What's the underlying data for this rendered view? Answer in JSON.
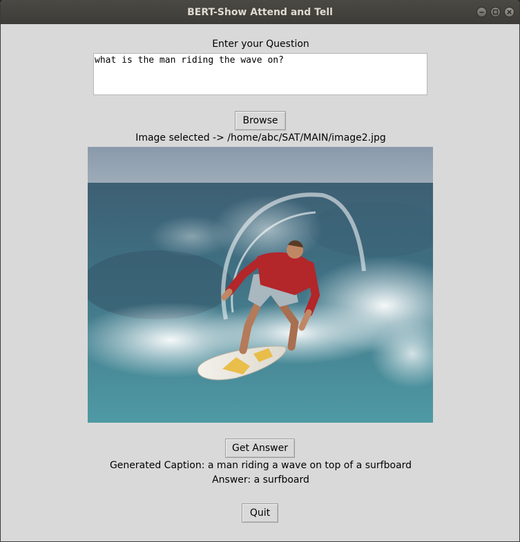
{
  "window": {
    "title": "BERT-Show Attend and Tell"
  },
  "question": {
    "label": "Enter your Question",
    "value": "what is the man riding the wave on?"
  },
  "browse": {
    "label": "Browse"
  },
  "image": {
    "selected_text": "Image selected -> /home/abc/SAT/MAIN/image2.jpg",
    "subject": "surfer riding a wave on a surfboard"
  },
  "get_answer": {
    "label": "Get Answer"
  },
  "results": {
    "caption": "Generated Caption: a man riding a wave on top of a surfboard",
    "answer": "Answer: a surfboard"
  },
  "quit": {
    "label": "Quit"
  }
}
